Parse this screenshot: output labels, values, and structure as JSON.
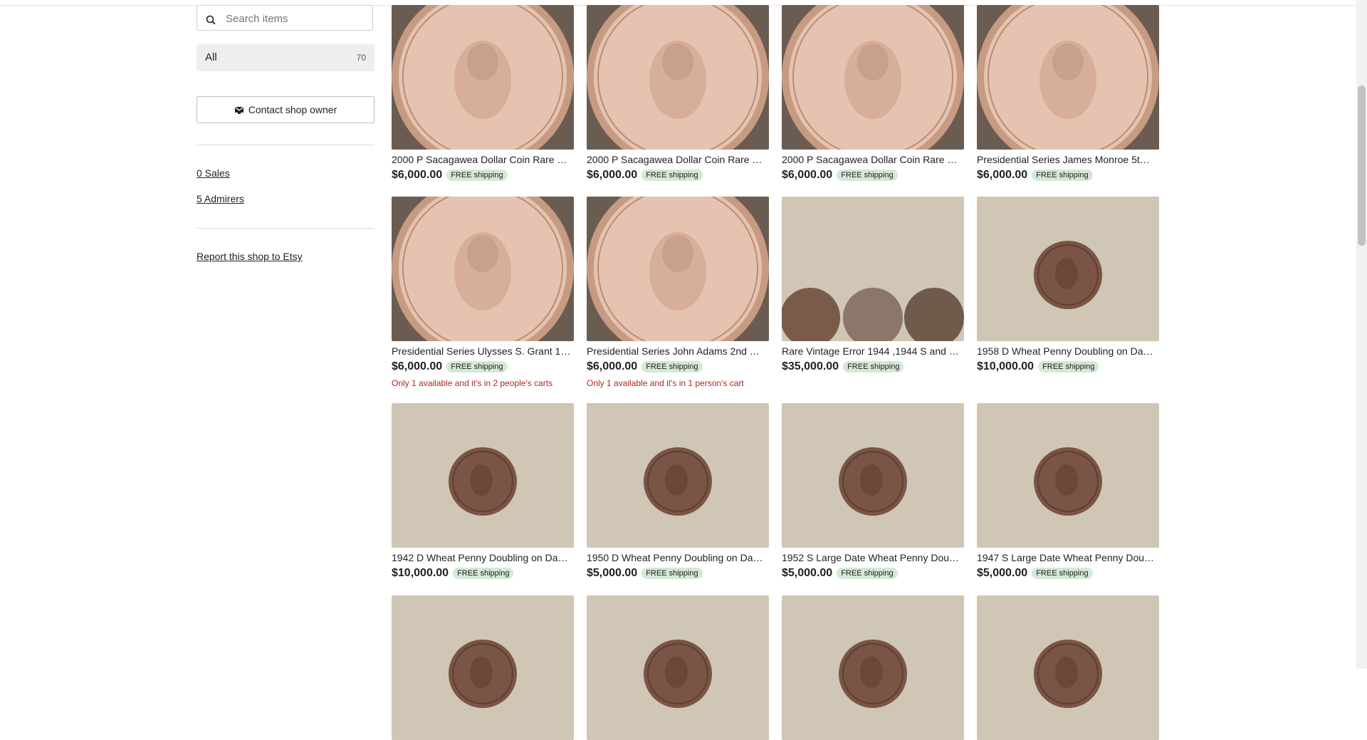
{
  "search": {
    "placeholder": "Search items"
  },
  "category": {
    "label": "All",
    "count": "70"
  },
  "contact_label": "Contact shop owner",
  "sales_label": "0 Sales",
  "admirers_label": "5 Admirers",
  "report_label": "Report this shop to Etsy",
  "free_shipping_label": "FREE shipping",
  "colors": {
    "shipping_badge": "#d4e9d7",
    "stock_warning": "#b3261e",
    "category_bg": "#eeeeee"
  },
  "listings": [
    {
      "title": "2000 P Sacagawea Dollar Coin Rare …",
      "price": "$6,000.00",
      "stock": "",
      "image": "gold-dollar-sacagawea"
    },
    {
      "title": "2000 P Sacagawea Dollar Coin Rare …",
      "price": "$6,000.00",
      "stock": "",
      "image": "gold-dollar-sacagawea"
    },
    {
      "title": "2000 P Sacagawea Dollar Coin Rare …",
      "price": "$6,000.00",
      "stock": "",
      "image": "gold-dollar-sacagawea"
    },
    {
      "title": "Presidential Series James Monroe 5t…",
      "price": "$6,000.00",
      "stock": "",
      "image": "gold-dollar-monroe"
    },
    {
      "title": "Presidential Series Ulysses S. Grant 1…",
      "price": "$6,000.00",
      "stock": "Only 1 available and it's in 2 people's carts",
      "image": "gold-dollar-grant"
    },
    {
      "title": "Presidential Series John Adams 2nd …",
      "price": "$6,000.00",
      "stock": "Only 1 available and it's in 1 person's cart",
      "image": "gold-dollar-adams"
    },
    {
      "title": "Rare Vintage Error 1944 ,1944 S and …",
      "price": "$35,000.00",
      "stock": "",
      "image": "three-wheat-pennies"
    },
    {
      "title": "1958 D Wheat Penny Doubling on Da…",
      "price": "$10,000.00",
      "stock": "",
      "image": "wheat-penny"
    },
    {
      "title": "1942 D Wheat Penny Doubling on Da…",
      "price": "$10,000.00",
      "stock": "",
      "image": "wheat-penny"
    },
    {
      "title": "1950 D Wheat Penny Doubling on Da…",
      "price": "$5,000.00",
      "stock": "",
      "image": "wheat-penny"
    },
    {
      "title": "1952 S Large Date Wheat Penny Dou…",
      "price": "$5,000.00",
      "stock": "",
      "image": "wheat-penny"
    },
    {
      "title": "1947 S Large Date Wheat Penny Dou…",
      "price": "$5,000.00",
      "stock": "",
      "image": "wheat-penny"
    },
    {
      "title": "",
      "price": "",
      "stock": "",
      "image": "wheat-penny"
    },
    {
      "title": "",
      "price": "",
      "stock": "",
      "image": "wheat-penny"
    },
    {
      "title": "",
      "price": "",
      "stock": "",
      "image": "wheat-penny"
    },
    {
      "title": "",
      "price": "",
      "stock": "",
      "image": "wheat-penny"
    }
  ]
}
